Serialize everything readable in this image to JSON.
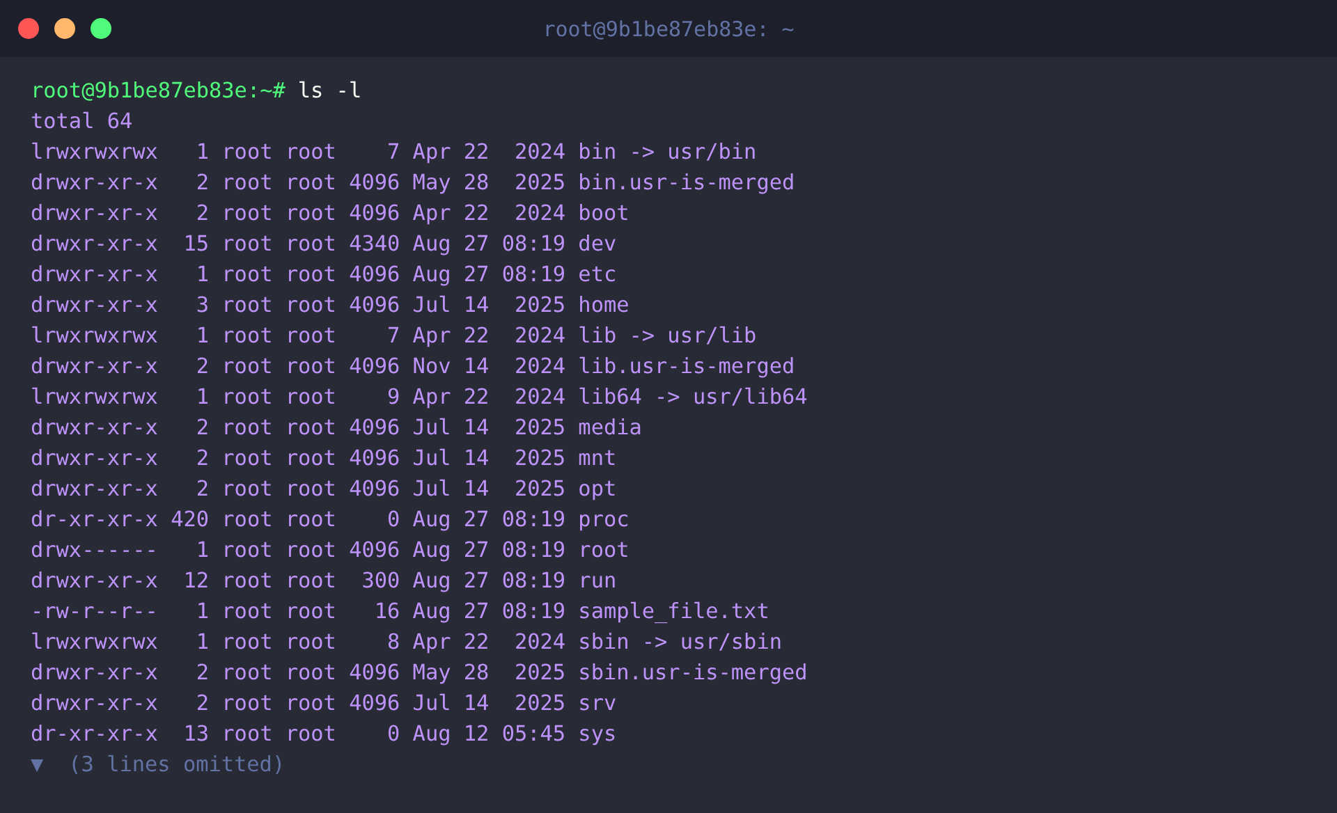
{
  "window": {
    "title": "root@9b1be87eb83e: ~"
  },
  "prompt": {
    "user_host": "root@9b1be87eb83e:~#",
    "command": "ls -l"
  },
  "output": [
    "total 64",
    "lrwxrwxrwx   1 root root    7 Apr 22  2024 bin -> usr/bin",
    "drwxr-xr-x   2 root root 4096 May 28  2025 bin.usr-is-merged",
    "drwxr-xr-x   2 root root 4096 Apr 22  2024 boot",
    "drwxr-xr-x  15 root root 4340 Aug 27 08:19 dev",
    "drwxr-xr-x   1 root root 4096 Aug 27 08:19 etc",
    "drwxr-xr-x   3 root root 4096 Jul 14  2025 home",
    "lrwxrwxrwx   1 root root    7 Apr 22  2024 lib -> usr/lib",
    "drwxr-xr-x   2 root root 4096 Nov 14  2024 lib.usr-is-merged",
    "lrwxrwxrwx   1 root root    9 Apr 22  2024 lib64 -> usr/lib64",
    "drwxr-xr-x   2 root root 4096 Jul 14  2025 media",
    "drwxr-xr-x   2 root root 4096 Jul 14  2025 mnt",
    "drwxr-xr-x   2 root root 4096 Jul 14  2025 opt",
    "dr-xr-xr-x 420 root root    0 Aug 27 08:19 proc",
    "drwx------   1 root root 4096 Aug 27 08:19 root",
    "drwxr-xr-x  12 root root  300 Aug 27 08:19 run",
    "-rw-r--r--   1 root root   16 Aug 27 08:19 sample_file.txt",
    "lrwxrwxrwx   1 root root    8 Apr 22  2024 sbin -> usr/sbin",
    "drwxr-xr-x   2 root root 4096 May 28  2025 sbin.usr-is-merged",
    "drwxr-xr-x   2 root root 4096 Jul 14  2025 srv",
    "dr-xr-xr-x  13 root root    0 Aug 12 05:45 sys"
  ],
  "omitted": {
    "toggle": "▼",
    "text": "(3 lines omitted)"
  }
}
